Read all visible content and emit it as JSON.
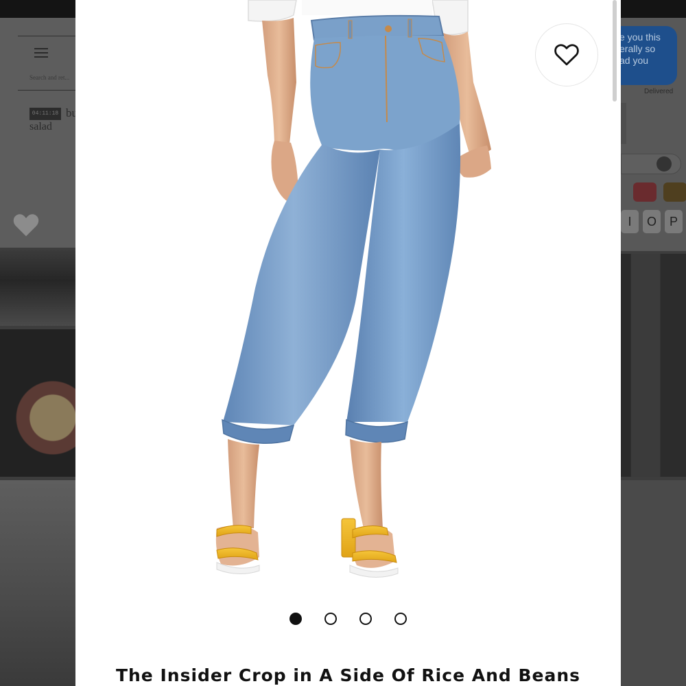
{
  "background_app": {
    "search_placeholder": "Search and ret...",
    "timestamp": "04:11:18",
    "word_fragment": "bu",
    "note_text": "salad",
    "message_lines": [
      "e you this",
      "erally so",
      "ad you"
    ],
    "delivered": "Delivered",
    "keys": [
      "I",
      "O",
      "P"
    ]
  },
  "product": {
    "title": "The Insider Crop in A Side Of Rice And Beans",
    "favorite_icon": "heart-outline-icon",
    "carousel": {
      "total": 4,
      "active_index": 0
    }
  },
  "colors": {
    "denim": "#6f97c4",
    "sandal": "#f0b722",
    "overlay": "#3d3d3d"
  }
}
